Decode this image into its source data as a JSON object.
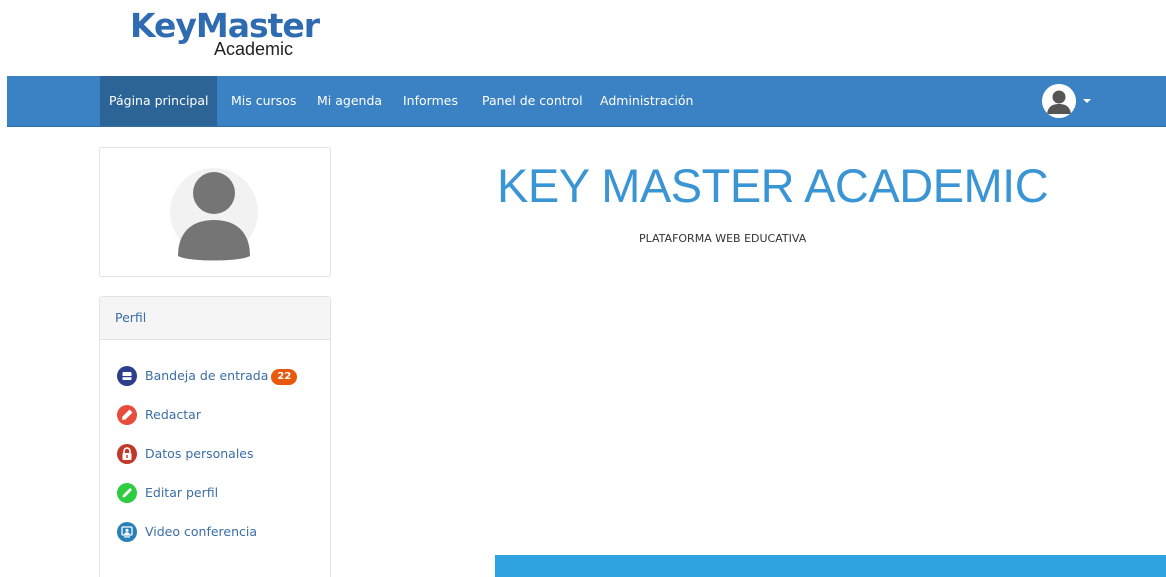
{
  "logo": {
    "main": "KeyMaster",
    "sub": "Academic"
  },
  "navbar": {
    "items": [
      {
        "label": "Página principal"
      },
      {
        "label": "Mis cursos"
      },
      {
        "label": "Mi agenda"
      },
      {
        "label": "Informes"
      },
      {
        "label": "Panel de control"
      },
      {
        "label": "Administración"
      }
    ],
    "user_icon": "user-avatar-icon"
  },
  "profile": {
    "header": "Perfil",
    "items": [
      {
        "label": "Bandeja de entrada",
        "badge": "22",
        "icon": "inbox-icon",
        "color": "#2c3e8c"
      },
      {
        "label": "Redactar",
        "icon": "pen-icon",
        "color": "#e74c3c"
      },
      {
        "label": "Datos personales",
        "icon": "lock-icon",
        "color": "#c0392b"
      },
      {
        "label": "Editar perfil",
        "icon": "pencil-icon",
        "color": "#2ecc40"
      },
      {
        "label": "Video conferencia",
        "icon": "video-conference-icon",
        "color": "#2980b9"
      }
    ]
  },
  "main": {
    "title": "KEY MASTER ACADEMIC",
    "subtitle": "PLATAFORMA WEB EDUCATIVA"
  },
  "colors": {
    "navbar": "#3a82c3",
    "navbar_active": "#2c6498",
    "title": "#3a95d5",
    "badge": "#e8590c",
    "banner": "#2fa3e0"
  }
}
